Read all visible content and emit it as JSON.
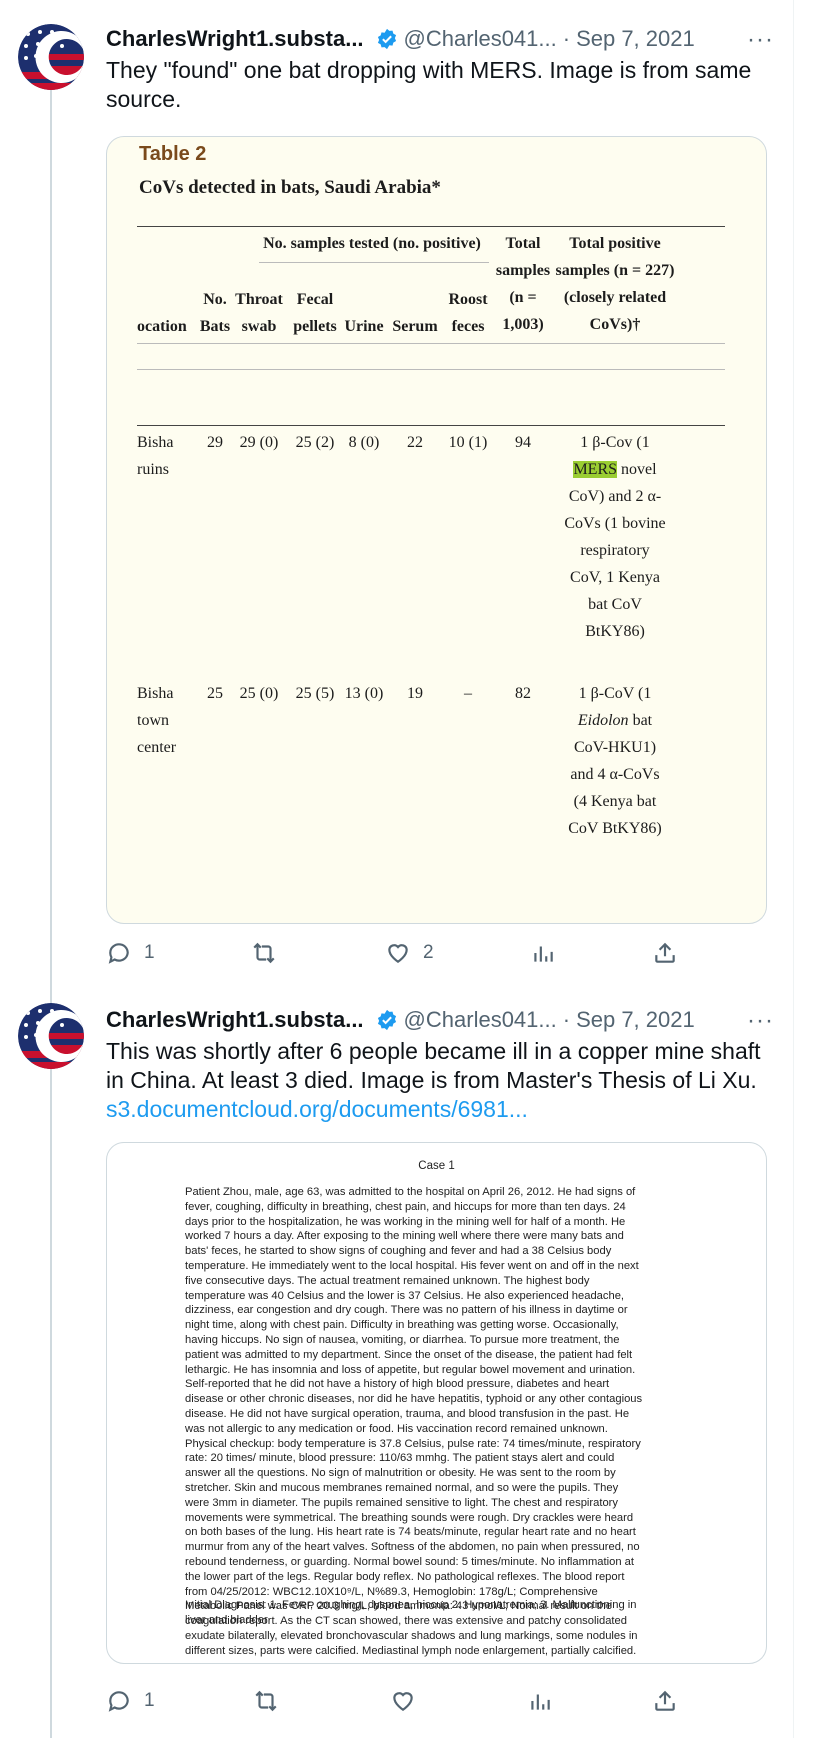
{
  "colors": {
    "link": "#1d9bf0",
    "muted": "#536471",
    "verified": "#1d9bf0",
    "table_bg": "#fefdf0",
    "highlight": "#9acd32"
  },
  "tweets": [
    {
      "author": "CharlesWright1.substa...",
      "handle": "@Charles041...",
      "date": "Sep 7, 2021",
      "separator": "·",
      "more": "···",
      "text": "They \"found\" one bat dropping with MERS.  Image is from same source.",
      "replies": "1",
      "retweets": "",
      "likes": "2",
      "image": {
        "label": "Table 2",
        "title": "CoVs detected in bats, Saudi Arabia*",
        "group_header": "No. samples tested (no. positive)",
        "headers": [
          "ocation",
          "No. Bats",
          "Throat swab",
          "Fecal pellets",
          "Urine",
          "Serum",
          "Roost feces",
          "Total samples (n = 1,003)",
          "Total positive samples (n = 227) (closely related CoVs)†"
        ],
        "rows": [
          {
            "location": "Bisha ruins",
            "bats": "29",
            "throat": "29 (0)",
            "fecal": "25 (2)",
            "urine": "8 (0)",
            "serum": "22",
            "roost": "10 (1)",
            "total": "94",
            "positive_pre": "1 β-Cov (1 ",
            "positive_mark": "MERS",
            "positive_post": " novel CoV) and 2 α-CoVs (1 bovine respiratory CoV, 1 Kenya bat CoV BtKY86)"
          },
          {
            "location": "Bisha town center",
            "location_display": "Bisha town center",
            "bats": "25",
            "throat": "25 (0)",
            "fecal": "25 (5)",
            "urine": "13 (0)",
            "serum": "19",
            "roost": "–",
            "total": "82",
            "positive_a": "1 β-CoV (1",
            "positive_italic": "Eidolon",
            "positive_b": "bat CoV-HKU1) and 4 α-CoVs (4 Kenya bat CoV BtKY86)"
          }
        ]
      }
    },
    {
      "author": "CharlesWright1.substa...",
      "handle": "@Charles041...",
      "date": "Sep 7, 2021",
      "separator": "·",
      "more": "···",
      "text": "This was shortly after 6 people became ill in a copper mine shaft in China.  At least 3 died.  Image is from Master's Thesis of Li Xu. ",
      "link": "s3.documentcloud.org/documents/6981...",
      "replies": "1",
      "retweets": "",
      "likes": "",
      "image": {
        "title": "Case 1",
        "body": "Patient Zhou, male, age 63, was admitted to the hospital on April 26, 2012. He had signs of fever, coughing, difficulty in breathing, chest pain, and hiccups for more than ten days. 24 days prior to the hospitalization, he was working in the mining well for half of a month. He worked 7 hours a day. After exposing to the mining well where there were many bats and bats' feces, he started to show signs of coughing and fever and had a 38 Celsius body temperature. He immediately went to the local hospital. His fever went on and off in the next five consecutive days. The actual treatment remained unknown. The highest body temperature was 40 Celsius and the lower is 37 Celsius. He also experienced headache, dizziness, ear congestion and dry cough. There was no pattern of his illness in daytime or night time, along with chest pain. Difficulty in breathing was getting worse. Occasionally, having hiccups. No sign of nausea, vomiting, or diarrhea. To pursue more treatment, the patient was admitted to my department. Since the onset of the disease, the patient had felt lethargic. He has insomnia and loss of appetite, but regular bowel movement and urination. Self-reported that he did not have a history of high blood pressure, diabetes and heart disease or other chronic diseases, nor did he have hepatitis, typhoid or any other contagious disease. He did not have surgical operation, trauma, and blood transfusion in the past. He was not allergic to any medication or food. His vaccination record remained unknown. Physical checkup: body temperature is 37.8 Celsius, pulse rate: 74 times/minute, respiratory rate: 20 times/ minute, blood pressure: 110/63 mmhg. The patient stays alert and could answer all the questions. No sign of malnutrition or obesity. He was sent to the room by stretcher. Skin and mucous membranes remained normal, and so were the pupils. They were 3mm in diameter. The pupils remained sensitive to light. The chest and respiratory movements were symmetrical. The breathing sounds were rough. Dry crackles were heard on both bases of the lung. His heart rate is 74 beats/minute, regular heart rate and no heart murmur from any of the heart valves. Softness of the abdomen, no pain when pressured, no rebound tenderness, or guarding. Normal bowel sound: 5 times/minute. No inflammation at the lower part of the legs. Regular body reflex. No pathological reflexes. The blood report from 04/25/2012: WBC12.10X10⁹/L, N%89.3, Hemoglobin: 178g/L; Comprehensive Metabolic Panel was CRP 20.3 mg/L, blood ammonia: 43 umol/L; Normal result on the coagulation report. As the CT scan showed, there was extensive and patchy consolidated exudate bilaterally, elevated bronchovascular shadows and lung markings, some nodules in different sizes, parts were calcified. Mediastinal lymph node enlargement, partially calcified.",
        "diagnosis": "Initial Diagnosis: 1. Fever, coughing, dyspnea, hiccup 2. Hyponatremia; 3. Malfunctioning in liver and bladder"
      }
    }
  ]
}
